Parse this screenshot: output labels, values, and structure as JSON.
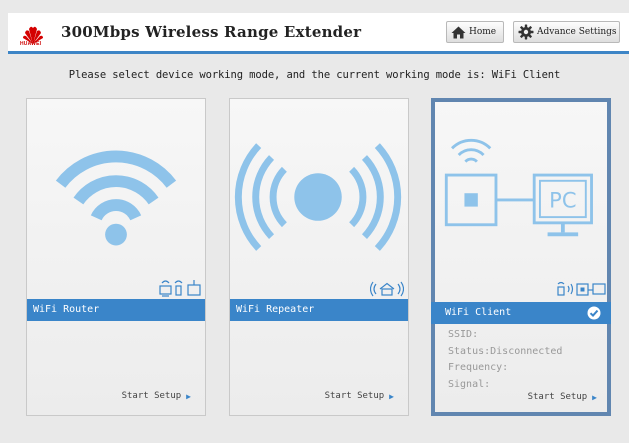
{
  "header": {
    "brand": "HUAWEI",
    "title": "300Mbps Wireless Range Extender",
    "home_label": "Home",
    "advance_label": "Advance Settings"
  },
  "instruction": "Please select device working mode, and the current working mode is: WiFi Client",
  "modes": [
    {
      "label": "WiFi Router",
      "setup": "Start Setup",
      "selected": false
    },
    {
      "label": "WiFi Repeater",
      "setup": "Start Setup",
      "selected": false
    },
    {
      "label": "WiFi Client",
      "setup": "Start Setup",
      "selected": true,
      "pc_label": "PC",
      "status": {
        "ssid": "SSID:",
        "status": "Status:Disconnected",
        "frequency": "Frequency:",
        "signal": "Signal:"
      }
    }
  ],
  "colors": {
    "accent": "#3a85c9",
    "illustration": "#8ec3ea",
    "selected_border": "#6186b0",
    "brand_red": "#cc0000"
  }
}
